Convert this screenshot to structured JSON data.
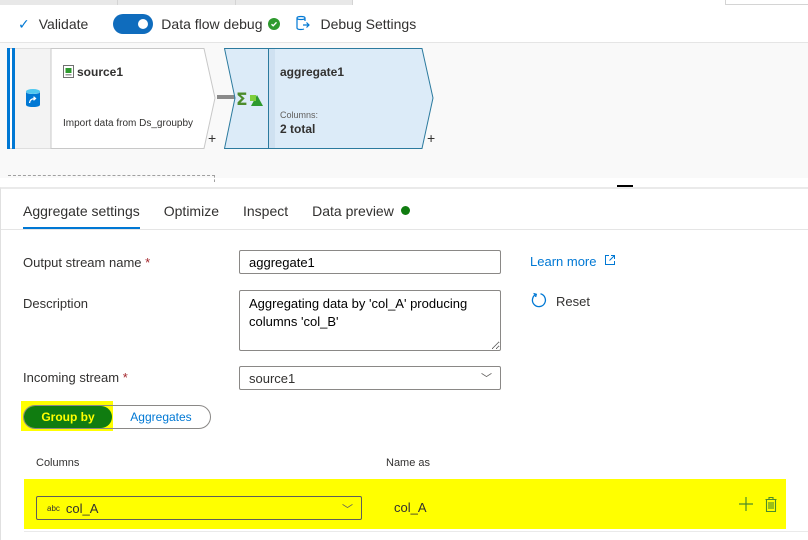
{
  "toolbar": {
    "validate_label": "Validate",
    "debug_label": "Data flow debug",
    "debug_on": true,
    "debug_settings_label": "Debug Settings"
  },
  "canvas": {
    "source_node": {
      "title": "source1",
      "description": "Import data from Ds_groupby"
    },
    "aggregate_node": {
      "title": "aggregate1",
      "columns_label": "Columns:",
      "columns_value": "2 total"
    },
    "add_symbol": "+"
  },
  "pane": {
    "tabs": [
      {
        "label": "Aggregate settings",
        "active": true
      },
      {
        "label": "Optimize",
        "active": false
      },
      {
        "label": "Inspect",
        "active": false
      },
      {
        "label": "Data preview",
        "active": false
      }
    ],
    "output_stream": {
      "label": "Output stream name",
      "required": "*",
      "value": "aggregate1"
    },
    "description": {
      "label": "Description",
      "value": "Aggregating data by 'col_A' producing columns 'col_B'"
    },
    "incoming_stream": {
      "label": "Incoming stream",
      "required": "*",
      "value": "source1"
    },
    "learn_more": "Learn more",
    "reset": "Reset",
    "segmented": {
      "group_by": "Group by",
      "aggregates": "Aggregates",
      "selected": "Group by"
    },
    "table": {
      "headers": {
        "columns": "Columns",
        "name_as": "Name as"
      },
      "rows": [
        {
          "type_badge": "abc",
          "column": "col_A",
          "name_as": "col_A"
        }
      ]
    }
  },
  "colors": {
    "accent": "#0078d4",
    "highlight": "#ffff00",
    "green": "#107c10",
    "node_fill": "#dcebf8"
  }
}
